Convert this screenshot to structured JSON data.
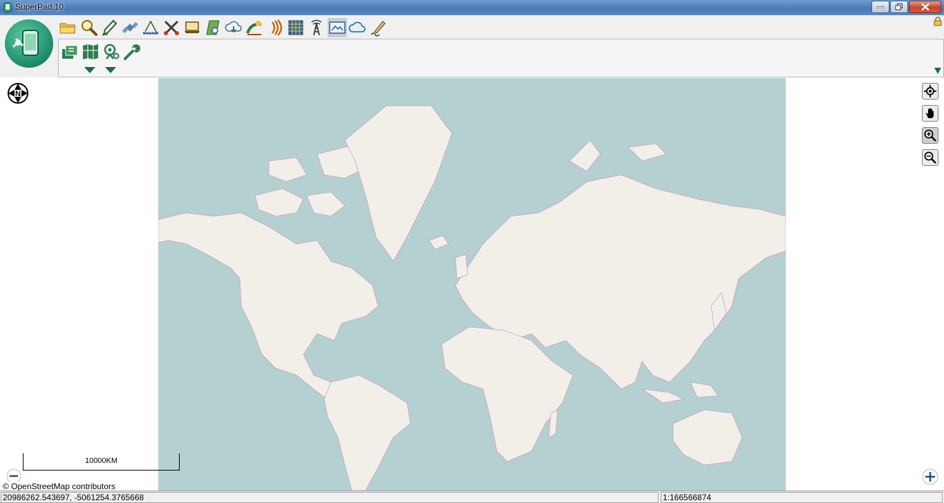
{
  "window": {
    "title": "SuperPad 10"
  },
  "toolbar": {
    "row1_icons": [
      "folder-open-icon",
      "search-icon",
      "pencil-edit-icon",
      "satellite-icon",
      "measure-icon",
      "scissors-cut-icon",
      "laptop-icon",
      "map-view-icon",
      "cloud-download-icon",
      "gps-track-icon",
      "signal-icon",
      "grid-icon",
      "tower-icon",
      "photo-map-icon",
      "cloud-icon",
      "pen-sign-icon"
    ],
    "row1_active_index": 13,
    "row2_icons": [
      "layers-icon",
      "map-book-icon",
      "gps-settings-icon",
      "wrench-icon"
    ]
  },
  "map": {
    "north_label": "N",
    "scale_label": "10000KM",
    "attribution": "© OpenStreetMap contributors",
    "colors": {
      "ocean": "#b5d0d0",
      "land": "#f2efe9",
      "border": "#c79ec6"
    }
  },
  "status": {
    "coordinates": "20986262.543697, -5061254.3765668",
    "scale": "1:166566874"
  }
}
